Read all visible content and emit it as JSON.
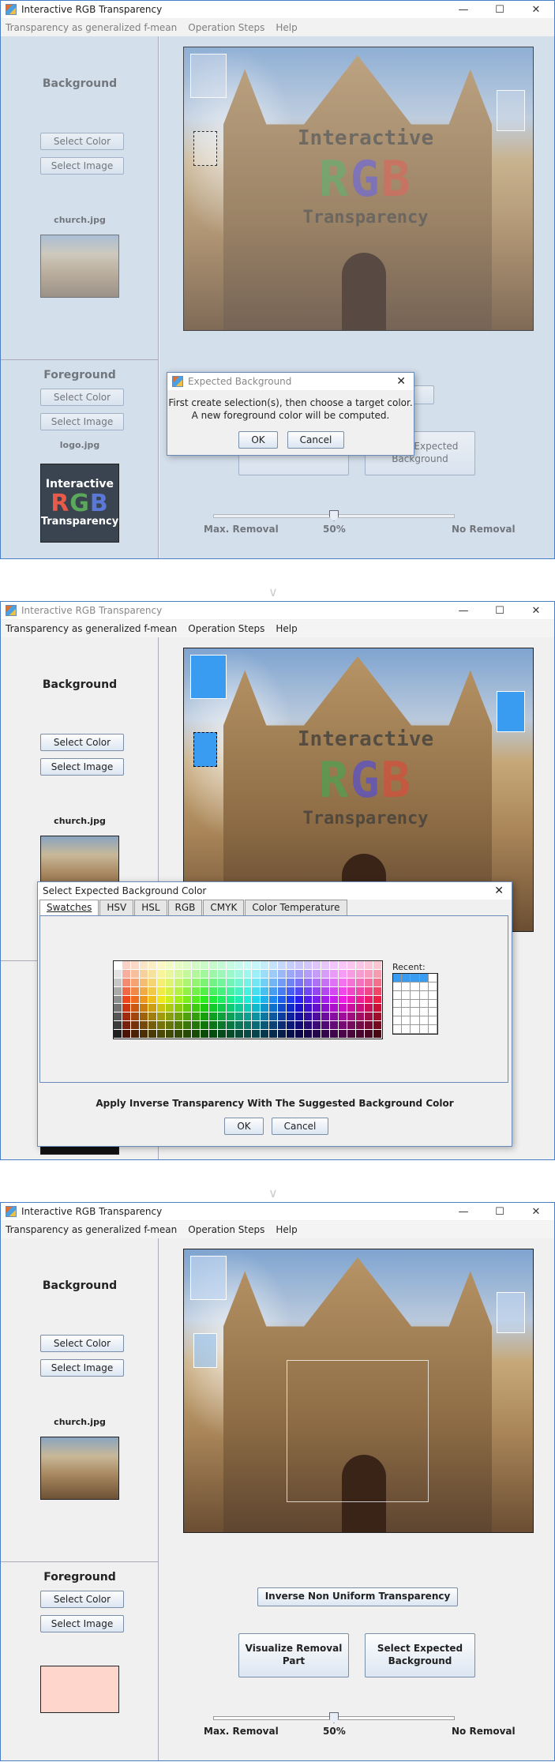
{
  "window": {
    "title": "Interactive RGB Transparency",
    "minimize": "—",
    "maximize": "☐",
    "close": "✕"
  },
  "menu": [
    "Transparency as generalized f-mean",
    "Operation Steps",
    "Help"
  ],
  "left": {
    "background_title": "Background",
    "foreground_title": "Foreground",
    "select_color": "Select Color",
    "select_image": "Select Image",
    "bg_file": "church.jpg",
    "fg_file": "logo.jpg",
    "logo_top": "Interactive",
    "logo_rgb": [
      "R",
      "G",
      "B"
    ],
    "logo_bottom": "Transparency"
  },
  "right": {
    "inverse_button": "Inverse Non Uniform Transparency",
    "visualize_button": "Visualize Removal Part",
    "expected_bg_button": "Select Expected Background",
    "slider_min": "Max. Removal",
    "slider_mid": "50%",
    "slider_max": "No Removal",
    "slider_value": 0.5
  },
  "overlay_logo": {
    "top": "Interactive",
    "rgb": [
      "R",
      "G",
      "B"
    ],
    "bottom": "Transparency"
  },
  "dialog1": {
    "title": "Expected Background",
    "line1": "First create selection(s), then choose a target color.",
    "line2": "A new foreground color will be computed.",
    "ok": "OK",
    "cancel": "Cancel"
  },
  "dialog2": {
    "title": "Select Expected Background Color",
    "tabs": [
      "Swatches",
      "HSV",
      "HSL",
      "RGB",
      "CMYK",
      "Color Temperature"
    ],
    "recent_label": "Recent:",
    "apply_text": "Apply Inverse Transparency With The Suggested Background Color",
    "ok": "OK",
    "cancel": "Cancel"
  },
  "colors": {
    "selection_blue": "#3a9cf0",
    "foreground_result": "#ffd6cc",
    "left_panel_tint": "#d4dfec"
  },
  "step_arrow": "∨"
}
